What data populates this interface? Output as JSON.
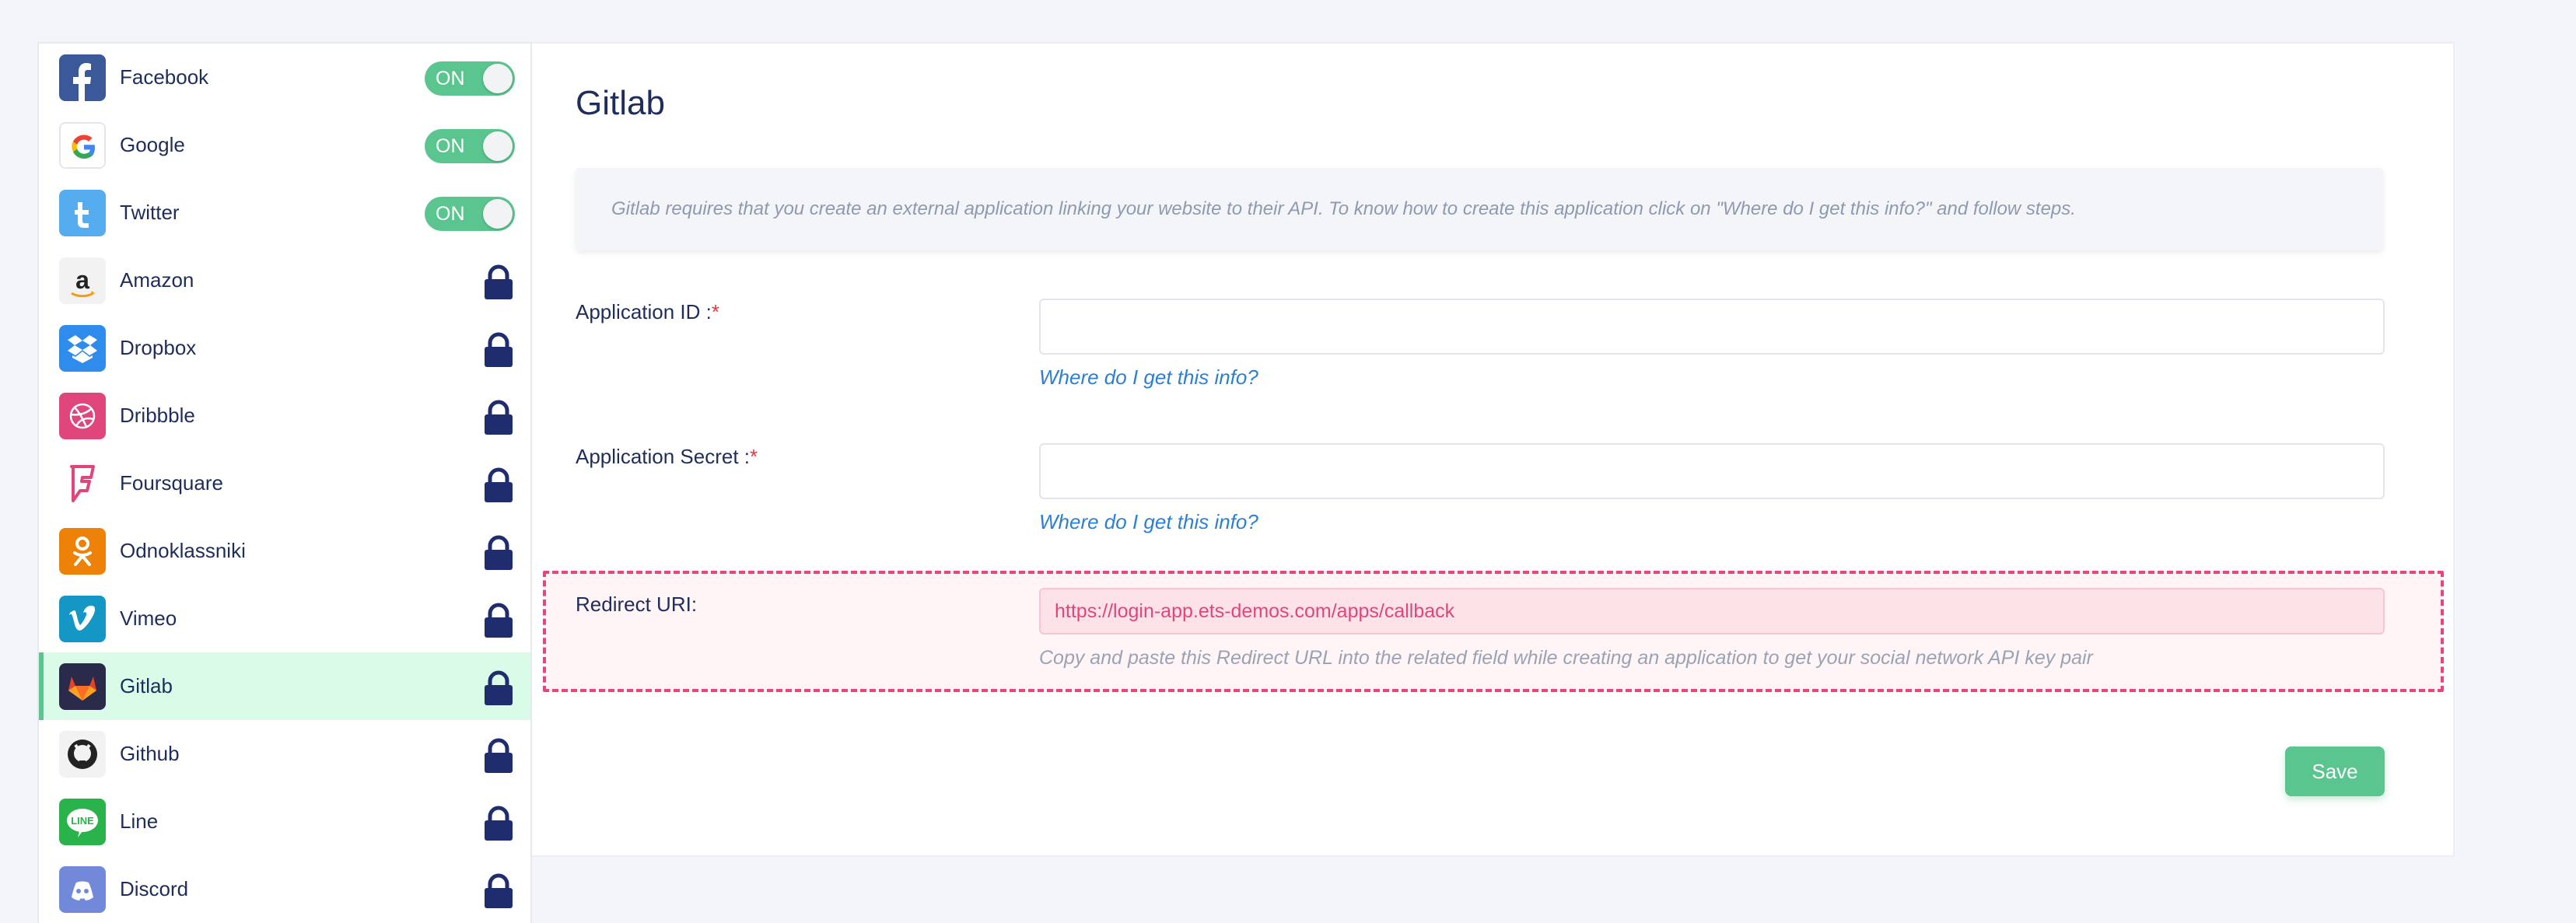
{
  "sidebar": {
    "items": [
      {
        "label": "Facebook",
        "status": "on",
        "toggle_text": "ON",
        "icon": "facebook-icon",
        "color": "#3b5998"
      },
      {
        "label": "Google",
        "status": "on",
        "toggle_text": "ON",
        "icon": "google-icon",
        "color": "#ffffff"
      },
      {
        "label": "Twitter",
        "status": "on",
        "toggle_text": "ON",
        "icon": "twitter-icon",
        "color": "#55acee"
      },
      {
        "label": "Amazon",
        "status": "locked",
        "icon": "amazon-icon",
        "color": "#f2f2f2"
      },
      {
        "label": "Dropbox",
        "status": "locked",
        "icon": "dropbox-icon",
        "color": "#2f8cec"
      },
      {
        "label": "Dribbble",
        "status": "locked",
        "icon": "dribbble-icon",
        "color": "#e0457b"
      },
      {
        "label": "Foursquare",
        "status": "locked",
        "icon": "foursquare-icon",
        "color": "#ffffff"
      },
      {
        "label": "Odnoklassniki",
        "status": "locked",
        "icon": "odnoklassniki-icon",
        "color": "#ee8208"
      },
      {
        "label": "Vimeo",
        "status": "locked",
        "icon": "vimeo-icon",
        "color": "#1597c6"
      },
      {
        "label": "Gitlab",
        "status": "locked",
        "active": true,
        "icon": "gitlab-icon",
        "color": "#2a2a4a"
      },
      {
        "label": "Github",
        "status": "locked",
        "icon": "github-icon",
        "color": "#f2f2f2"
      },
      {
        "label": "Line",
        "status": "locked",
        "icon": "line-icon",
        "color": "#2ab34a"
      },
      {
        "label": "Discord",
        "status": "locked",
        "icon": "discord-icon",
        "color": "#7289da"
      }
    ],
    "lock_icon": "lock-icon",
    "lock_color": "#1f2d6e",
    "toggle_color": "#5bc58f"
  },
  "main": {
    "title": "Gitlab",
    "notice": "Gitlab requires that you create an external application linking your website to their API. To know how to create this application click on \"Where do I get this info?\" and follow steps.",
    "fields": [
      {
        "label": "Application ID :",
        "required_mark": "*",
        "value": "",
        "help": "Where do I get this info?"
      },
      {
        "label": "Application Secret :",
        "required_mark": "*",
        "value": "",
        "help": "Where do I get this info?"
      }
    ],
    "redirect": {
      "label": "Redirect URI:",
      "url": "https://login-app.ets-demos.com/apps/callback",
      "help": "Copy and paste this Redirect URL into the related field while creating an application to get your social network API key pair"
    },
    "save_label": "Save"
  },
  "colors": {
    "accent": "#5bc58f",
    "link": "#2b7fd4",
    "highlight_border": "#e8467a",
    "required": "#e5363d"
  }
}
